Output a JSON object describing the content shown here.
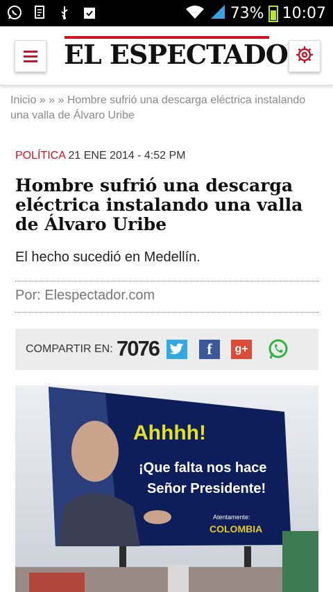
{
  "status_bar": {
    "battery": "73%",
    "time": "10:07",
    "icons": [
      "whatsapp-icon",
      "document-icon",
      "usb-icon",
      "clipboard-check-icon",
      "wifi-icon",
      "signal-icon",
      "battery-icon"
    ]
  },
  "header": {
    "logo": "EL ESPECTADOR",
    "brand_color": "#d0111f"
  },
  "breadcrumb": {
    "home": "Inicio",
    "separators": "» » »",
    "current": "Hombre sufrió una descarga eléctrica instalando una valla de Álvaro Uribe"
  },
  "article": {
    "section": "POLÍTICA",
    "date": "21 ENE 2014 - 4:52 PM",
    "title": "Hombre sufrió una descarga eléctrica instalando una valla de Álvaro Uribe",
    "subtitle": "El hecho sucedió en Medellín.",
    "byline": "Por: Elespectador.com"
  },
  "share": {
    "label": "COMPARTIR EN:",
    "count": "7076",
    "networks": [
      "twitter-icon",
      "facebook-icon",
      "google-plus-icon",
      "whatsapp-icon"
    ]
  },
  "photo": {
    "billboard_headline": "Ahhhh!",
    "billboard_line1": "¡Que falta nos hace",
    "billboard_line2": "Señor Presidente!",
    "billboard_sign": "Atentamente:",
    "billboard_signature": "COLOMBIA"
  }
}
